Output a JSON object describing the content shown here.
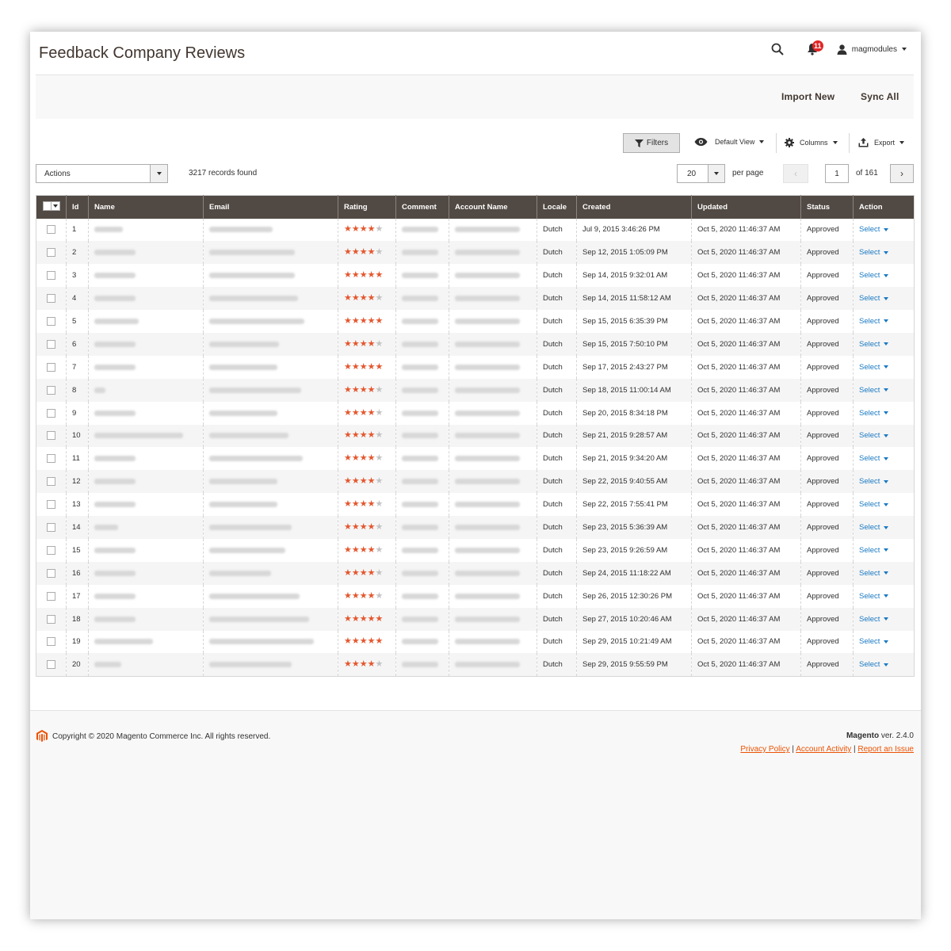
{
  "header": {
    "title": "Feedback Company Reviews",
    "notification_count": "11",
    "user_name": "magmodules"
  },
  "actions_bar": {
    "import_label": "Import New",
    "sync_label": "Sync All"
  },
  "toolbar": {
    "filters_label": "Filters",
    "view_label": "Default View",
    "columns_label": "Columns",
    "export_label": "Export",
    "mass_actions_label": "Actions",
    "records_found": "3217 records found",
    "per_page_value": "20",
    "per_page_label": "per page",
    "page_value": "1",
    "page_of": "of 161"
  },
  "grid": {
    "columns": [
      "Id",
      "Name",
      "Email",
      "Rating",
      "Comment",
      "Account Name",
      "Locale",
      "Created",
      "Updated",
      "Status",
      "Action"
    ],
    "rows": [
      {
        "id": "1",
        "rating": 4,
        "locale": "Dutch",
        "created": "Jul 9, 2015 3:46:26 PM",
        "updated": "Oct 5, 2020 11:46:37 AM",
        "status": "Approved",
        "action": "Select"
      },
      {
        "id": "2",
        "rating": 4,
        "locale": "Dutch",
        "created": "Sep 12, 2015 1:05:09 PM",
        "updated": "Oct 5, 2020 11:46:37 AM",
        "status": "Approved",
        "action": "Select"
      },
      {
        "id": "3",
        "rating": 5,
        "locale": "Dutch",
        "created": "Sep 14, 2015 9:32:01 AM",
        "updated": "Oct 5, 2020 11:46:37 AM",
        "status": "Approved",
        "action": "Select"
      },
      {
        "id": "4",
        "rating": 4,
        "locale": "Dutch",
        "created": "Sep 14, 2015 11:58:12 AM",
        "updated": "Oct 5, 2020 11:46:37 AM",
        "status": "Approved",
        "action": "Select"
      },
      {
        "id": "5",
        "rating": 5,
        "locale": "Dutch",
        "created": "Sep 15, 2015 6:35:39 PM",
        "updated": "Oct 5, 2020 11:46:37 AM",
        "status": "Approved",
        "action": "Select"
      },
      {
        "id": "6",
        "rating": 4,
        "locale": "Dutch",
        "created": "Sep 15, 2015 7:50:10 PM",
        "updated": "Oct 5, 2020 11:46:37 AM",
        "status": "Approved",
        "action": "Select"
      },
      {
        "id": "7",
        "rating": 5,
        "locale": "Dutch",
        "created": "Sep 17, 2015 2:43:27 PM",
        "updated": "Oct 5, 2020 11:46:37 AM",
        "status": "Approved",
        "action": "Select"
      },
      {
        "id": "8",
        "rating": 4,
        "locale": "Dutch",
        "created": "Sep 18, 2015 11:00:14 AM",
        "updated": "Oct 5, 2020 11:46:37 AM",
        "status": "Approved",
        "action": "Select"
      },
      {
        "id": "9",
        "rating": 4,
        "locale": "Dutch",
        "created": "Sep 20, 2015 8:34:18 PM",
        "updated": "Oct 5, 2020 11:46:37 AM",
        "status": "Approved",
        "action": "Select"
      },
      {
        "id": "10",
        "rating": 4,
        "locale": "Dutch",
        "created": "Sep 21, 2015 9:28:57 AM",
        "updated": "Oct 5, 2020 11:46:37 AM",
        "status": "Approved",
        "action": "Select"
      },
      {
        "id": "11",
        "rating": 4,
        "locale": "Dutch",
        "created": "Sep 21, 2015 9:34:20 AM",
        "updated": "Oct 5, 2020 11:46:37 AM",
        "status": "Approved",
        "action": "Select"
      },
      {
        "id": "12",
        "rating": 4,
        "locale": "Dutch",
        "created": "Sep 22, 2015 9:40:55 AM",
        "updated": "Oct 5, 2020 11:46:37 AM",
        "status": "Approved",
        "action": "Select"
      },
      {
        "id": "13",
        "rating": 4,
        "locale": "Dutch",
        "created": "Sep 22, 2015 7:55:41 PM",
        "updated": "Oct 5, 2020 11:46:37 AM",
        "status": "Approved",
        "action": "Select"
      },
      {
        "id": "14",
        "rating": 4,
        "locale": "Dutch",
        "created": "Sep 23, 2015 5:36:39 AM",
        "updated": "Oct 5, 2020 11:46:37 AM",
        "status": "Approved",
        "action": "Select"
      },
      {
        "id": "15",
        "rating": 4,
        "locale": "Dutch",
        "created": "Sep 23, 2015 9:26:59 AM",
        "updated": "Oct 5, 2020 11:46:37 AM",
        "status": "Approved",
        "action": "Select"
      },
      {
        "id": "16",
        "rating": 4,
        "locale": "Dutch",
        "created": "Sep 24, 2015 11:18:22 AM",
        "updated": "Oct 5, 2020 11:46:37 AM",
        "status": "Approved",
        "action": "Select"
      },
      {
        "id": "17",
        "rating": 4,
        "locale": "Dutch",
        "created": "Sep 26, 2015 12:30:26 PM",
        "updated": "Oct 5, 2020 11:46:37 AM",
        "status": "Approved",
        "action": "Select"
      },
      {
        "id": "18",
        "rating": 5,
        "locale": "Dutch",
        "created": "Sep 27, 2015 10:20:46 AM",
        "updated": "Oct 5, 2020 11:46:37 AM",
        "status": "Approved",
        "action": "Select"
      },
      {
        "id": "19",
        "rating": 5,
        "locale": "Dutch",
        "created": "Sep 29, 2015 10:21:49 AM",
        "updated": "Oct 5, 2020 11:46:37 AM",
        "status": "Approved",
        "action": "Select"
      },
      {
        "id": "20",
        "rating": 4,
        "locale": "Dutch",
        "created": "Sep 29, 2015 9:55:59 PM",
        "updated": "Oct 5, 2020 11:46:37 AM",
        "status": "Approved",
        "action": "Select"
      }
    ]
  },
  "footer": {
    "copyright": "Copyright © 2020 Magento Commerce Inc. All rights reserved.",
    "brand": "Magento",
    "version": " ver. 2.4.0",
    "privacy_link": "Privacy Policy",
    "activity_link": "Account Activity",
    "issue_link": "Report an Issue",
    "separator": " | "
  },
  "colors": {
    "header_bg": "#514943",
    "star_on": "#e4572e",
    "star_off": "#c2c2c2",
    "link_blue": "#1979c3",
    "footer_link": "#eb5202",
    "badge_red": "#e22626"
  },
  "icons": {
    "search": "search-icon",
    "notifications": "bell-icon",
    "user": "user-icon",
    "filter": "funnel-icon",
    "view": "eye-icon",
    "columns": "gear-icon",
    "export": "upload-icon",
    "logo": "magento-logo"
  }
}
